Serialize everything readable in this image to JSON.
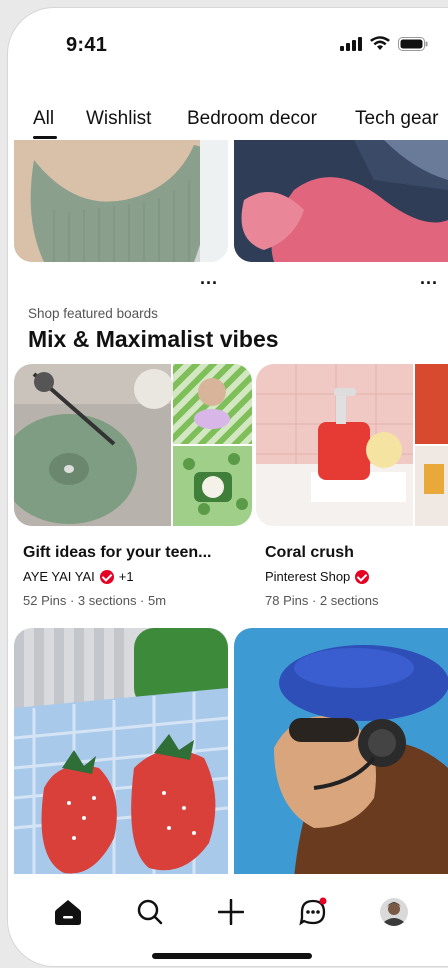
{
  "status": {
    "time": "9:41"
  },
  "tabs": [
    {
      "label": "All",
      "active": true
    },
    {
      "label": "Wishlist",
      "active": false
    },
    {
      "label": "Bedroom decor",
      "active": false
    },
    {
      "label": "Tech gear",
      "active": false
    }
  ],
  "pins": {
    "more_label": "...",
    "top_left_alt": "Green ribbed tank top",
    "top_right_alt": "Pink knit sweater"
  },
  "featured": {
    "label": "Shop featured boards",
    "title": "Mix & Maximalist vibes",
    "boards": [
      {
        "title": "Gift ideas for your teen...",
        "owner": "AYE YAI YAI",
        "extra": "+1",
        "meta": "52 Pins · 3 sections · 5m"
      },
      {
        "title": "Coral crush",
        "owner": "Pinterest Shop",
        "extra": "",
        "meta": "78 Pins · 2 sections"
      }
    ]
  },
  "nav": {
    "items": [
      "home-icon",
      "search-icon",
      "plus-icon",
      "messages-icon",
      "avatar"
    ]
  },
  "colors": {
    "brand": "#e60023",
    "text": "#111111",
    "muted": "#555555"
  }
}
